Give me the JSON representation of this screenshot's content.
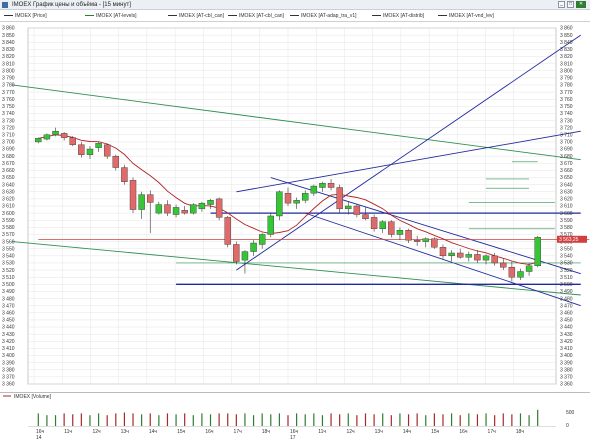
{
  "window": {
    "title": "IMOEX График цены и объёма - [15 минут]",
    "accent_color": "#2e7d32"
  },
  "legend": [
    {
      "label": "IMOEX [Price]",
      "color": "#222222"
    },
    {
      "label": "IMOEX [AT-levels]",
      "color": "#2e7d32"
    },
    {
      "label": "IMOEX [AT-cbl_can]",
      "color": "#222222"
    },
    {
      "label": "IMOEX [AT-cbl_can]",
      "color": "#222222"
    },
    {
      "label": "IMOEX [AT-adap_tra_v1]",
      "color": "#222222"
    },
    {
      "label": "IMOEX [AT-distrib]",
      "color": "#222222"
    },
    {
      "label": "IMOEX [AT-vnd_lev]",
      "color": "#222222"
    }
  ],
  "volume_panel": {
    "label": "IMOEX [Volume]",
    "right_labels": [
      "500",
      "0"
    ]
  },
  "chart_data": {
    "type": "candlestick",
    "y_axis": {
      "range": [
        3360,
        3860
      ],
      "step": 10,
      "position": "right",
      "current_price_label": "3 563,25",
      "current_price": 3563.25
    },
    "x_axis": {
      "day_labels": [
        {
          "label": "14",
          "sub": "16ч"
        },
        {
          "label": "17",
          "sub": "16ч"
        }
      ],
      "time_labels": [
        "16ч",
        "11ч",
        "12ч",
        "13ч",
        "14ч",
        "15ч",
        "16ч",
        "17ч",
        "18ч",
        "16ч",
        "11ч",
        "12ч",
        "13ч",
        "14ч",
        "15ч",
        "16ч",
        "17ч",
        "18ч"
      ]
    },
    "grid": true,
    "candles": [
      {
        "o": 3700,
        "h": 3706,
        "l": 3698,
        "c": 3705,
        "bull": true
      },
      {
        "o": 3704,
        "h": 3712,
        "l": 3702,
        "c": 3710,
        "bull": true
      },
      {
        "o": 3710,
        "h": 3720,
        "l": 3708,
        "c": 3715,
        "bull": true
      },
      {
        "o": 3712,
        "h": 3714,
        "l": 3702,
        "c": 3706,
        "bull": false
      },
      {
        "o": 3706,
        "h": 3708,
        "l": 3694,
        "c": 3696,
        "bull": false
      },
      {
        "o": 3696,
        "h": 3700,
        "l": 3678,
        "c": 3682,
        "bull": false
      },
      {
        "o": 3682,
        "h": 3694,
        "l": 3676,
        "c": 3690,
        "bull": true
      },
      {
        "o": 3692,
        "h": 3700,
        "l": 3686,
        "c": 3698,
        "bull": true
      },
      {
        "o": 3696,
        "h": 3698,
        "l": 3676,
        "c": 3680,
        "bull": false
      },
      {
        "o": 3680,
        "h": 3682,
        "l": 3660,
        "c": 3664,
        "bull": false
      },
      {
        "o": 3664,
        "h": 3668,
        "l": 3640,
        "c": 3644,
        "bull": false
      },
      {
        "o": 3646,
        "h": 3650,
        "l": 3600,
        "c": 3605,
        "bull": false
      },
      {
        "o": 3605,
        "h": 3630,
        "l": 3592,
        "c": 3626,
        "bull": true
      },
      {
        "o": 3626,
        "h": 3632,
        "l": 3572,
        "c": 3615,
        "bull": false
      },
      {
        "o": 3600,
        "h": 3616,
        "l": 3598,
        "c": 3612,
        "bull": true
      },
      {
        "o": 3612,
        "h": 3618,
        "l": 3596,
        "c": 3600,
        "bull": false
      },
      {
        "o": 3598,
        "h": 3612,
        "l": 3594,
        "c": 3608,
        "bull": true
      },
      {
        "o": 3604,
        "h": 3610,
        "l": 3598,
        "c": 3600,
        "bull": false
      },
      {
        "o": 3600,
        "h": 3614,
        "l": 3598,
        "c": 3612,
        "bull": true
      },
      {
        "o": 3606,
        "h": 3616,
        "l": 3602,
        "c": 3614,
        "bull": true
      },
      {
        "o": 3612,
        "h": 3620,
        "l": 3606,
        "c": 3618,
        "bull": true
      },
      {
        "o": 3620,
        "h": 3622,
        "l": 3590,
        "c": 3594,
        "bull": false
      },
      {
        "o": 3594,
        "h": 3596,
        "l": 3552,
        "c": 3556,
        "bull": false
      },
      {
        "o": 3556,
        "h": 3560,
        "l": 3528,
        "c": 3532,
        "bull": false
      },
      {
        "o": 3534,
        "h": 3548,
        "l": 3515,
        "c": 3546,
        "bull": true
      },
      {
        "o": 3546,
        "h": 3562,
        "l": 3540,
        "c": 3558,
        "bull": true
      },
      {
        "o": 3556,
        "h": 3572,
        "l": 3550,
        "c": 3570,
        "bull": true
      },
      {
        "o": 3570,
        "h": 3600,
        "l": 3566,
        "c": 3596,
        "bull": true
      },
      {
        "o": 3596,
        "h": 3632,
        "l": 3590,
        "c": 3630,
        "bull": true
      },
      {
        "o": 3628,
        "h": 3636,
        "l": 3610,
        "c": 3614,
        "bull": false
      },
      {
        "o": 3614,
        "h": 3622,
        "l": 3606,
        "c": 3618,
        "bull": true
      },
      {
        "o": 3618,
        "h": 3632,
        "l": 3614,
        "c": 3628,
        "bull": true
      },
      {
        "o": 3628,
        "h": 3640,
        "l": 3624,
        "c": 3638,
        "bull": true
      },
      {
        "o": 3636,
        "h": 3644,
        "l": 3630,
        "c": 3642,
        "bull": true
      },
      {
        "o": 3642,
        "h": 3648,
        "l": 3632,
        "c": 3636,
        "bull": false
      },
      {
        "o": 3636,
        "h": 3640,
        "l": 3600,
        "c": 3606,
        "bull": false
      },
      {
        "o": 3606,
        "h": 3616,
        "l": 3598,
        "c": 3610,
        "bull": true
      },
      {
        "o": 3610,
        "h": 3612,
        "l": 3594,
        "c": 3598,
        "bull": false
      },
      {
        "o": 3598,
        "h": 3608,
        "l": 3590,
        "c": 3592,
        "bull": false
      },
      {
        "o": 3594,
        "h": 3598,
        "l": 3574,
        "c": 3578,
        "bull": false
      },
      {
        "o": 3578,
        "h": 3590,
        "l": 3572,
        "c": 3588,
        "bull": true
      },
      {
        "o": 3588,
        "h": 3590,
        "l": 3566,
        "c": 3570,
        "bull": false
      },
      {
        "o": 3570,
        "h": 3580,
        "l": 3562,
        "c": 3576,
        "bull": true
      },
      {
        "o": 3576,
        "h": 3578,
        "l": 3558,
        "c": 3562,
        "bull": false
      },
      {
        "o": 3562,
        "h": 3568,
        "l": 3554,
        "c": 3560,
        "bull": false
      },
      {
        "o": 3560,
        "h": 3566,
        "l": 3552,
        "c": 3564,
        "bull": true
      },
      {
        "o": 3564,
        "h": 3566,
        "l": 3550,
        "c": 3552,
        "bull": false
      },
      {
        "o": 3552,
        "h": 3556,
        "l": 3536,
        "c": 3540,
        "bull": false
      },
      {
        "o": 3540,
        "h": 3548,
        "l": 3532,
        "c": 3544,
        "bull": true
      },
      {
        "o": 3544,
        "h": 3550,
        "l": 3536,
        "c": 3538,
        "bull": false
      },
      {
        "o": 3538,
        "h": 3546,
        "l": 3532,
        "c": 3542,
        "bull": true
      },
      {
        "o": 3542,
        "h": 3548,
        "l": 3530,
        "c": 3534,
        "bull": false
      },
      {
        "o": 3534,
        "h": 3542,
        "l": 3528,
        "c": 3540,
        "bull": true
      },
      {
        "o": 3540,
        "h": 3544,
        "l": 3526,
        "c": 3530,
        "bull": false
      },
      {
        "o": 3530,
        "h": 3536,
        "l": 3520,
        "c": 3524,
        "bull": false
      },
      {
        "o": 3524,
        "h": 3532,
        "l": 3504,
        "c": 3510,
        "bull": false
      },
      {
        "o": 3510,
        "h": 3522,
        "l": 3506,
        "c": 3518,
        "bull": true
      },
      {
        "o": 3518,
        "h": 3530,
        "l": 3512,
        "c": 3526,
        "bull": true
      },
      {
        "o": 3526,
        "h": 3568,
        "l": 3524,
        "c": 3566,
        "bull": true
      }
    ],
    "volume": [
      0.7,
      0.6,
      0.6,
      0.7,
      0.65,
      0.7,
      0.6,
      0.7,
      0.6,
      0.7,
      0.75,
      0.7,
      0.65,
      0.7,
      0.6,
      0.7,
      0.65,
      0.7,
      0.6,
      0.7,
      0.65,
      0.7,
      0.7,
      0.65,
      0.7,
      0.6,
      0.7,
      0.65,
      0.7,
      0.6,
      0.7,
      0.65,
      0.7,
      0.6,
      0.7,
      0.65,
      0.7,
      0.6,
      0.7,
      0.65,
      0.7,
      0.6,
      0.7,
      0.65,
      0.7,
      0.6,
      0.7,
      0.65,
      0.7,
      0.6,
      0.7,
      0.65,
      0.7,
      0.6,
      0.7,
      0.65,
      0.7,
      0.6,
      0.9
    ],
    "volume_colors_bull": "#2e7d32",
    "volume_colors_bear": "#a52a2a",
    "colors": {
      "bull": "#36c536",
      "bear": "#e06a6a",
      "moving_avg": "#b22222",
      "trend_green": "#2f8f4f",
      "channel_blue": "#1f2a9e",
      "price_line": "#d04040"
    }
  }
}
